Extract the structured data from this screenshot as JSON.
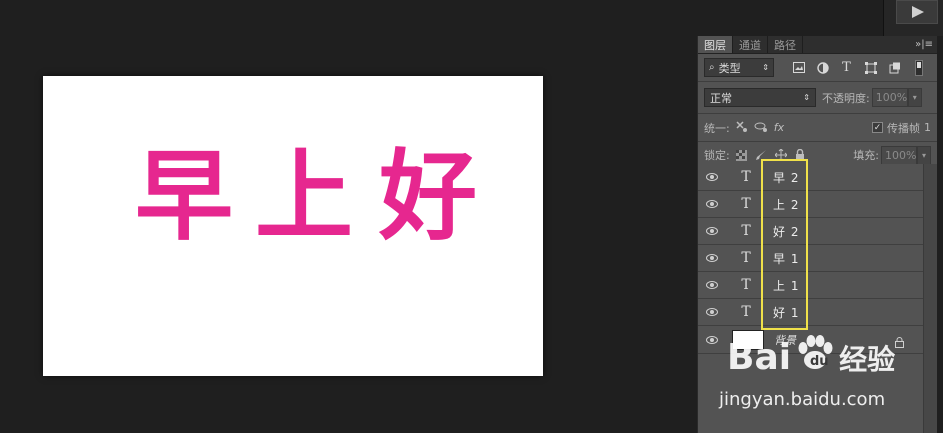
{
  "canvas": {
    "text_color": "#e6278f",
    "chars": [
      "早",
      "上",
      "好"
    ]
  },
  "panel": {
    "tabs": [
      "图层",
      "通道",
      "路径"
    ],
    "menu_icon": "»|≡",
    "filter": {
      "label": "类型",
      "prefix_icon": "search-icon"
    },
    "filter_icons": [
      "image-filter-icon",
      "adjustment-filter-icon",
      "text-filter-icon",
      "shape-filter-icon",
      "smart-object-filter-icon"
    ],
    "blend_mode": "正常",
    "opacity_label": "不透明度:",
    "opacity_value": "100%",
    "unify_label": "统一:",
    "propagate_label": "传播帧",
    "propagate_value": "1",
    "lock_label": "锁定:",
    "fill_label": "填充:",
    "fill_value": "100%",
    "layers": [
      {
        "type": "T",
        "name": "早 2"
      },
      {
        "type": "T",
        "name": "上 2"
      },
      {
        "type": "T",
        "name": "好 2"
      },
      {
        "type": "T",
        "name": "早 1"
      },
      {
        "type": "T",
        "name": "上 1"
      },
      {
        "type": "T",
        "name": "好 1"
      }
    ],
    "background_layer": "背景"
  },
  "watermark": {
    "brand": "Bai",
    "brand_suffix": "经验",
    "url": "jingyan.baidu.com"
  },
  "colors": {
    "highlight": "#f0e14a",
    "panel_bg": "#535353",
    "workspace_bg": "#1f1f1f"
  }
}
